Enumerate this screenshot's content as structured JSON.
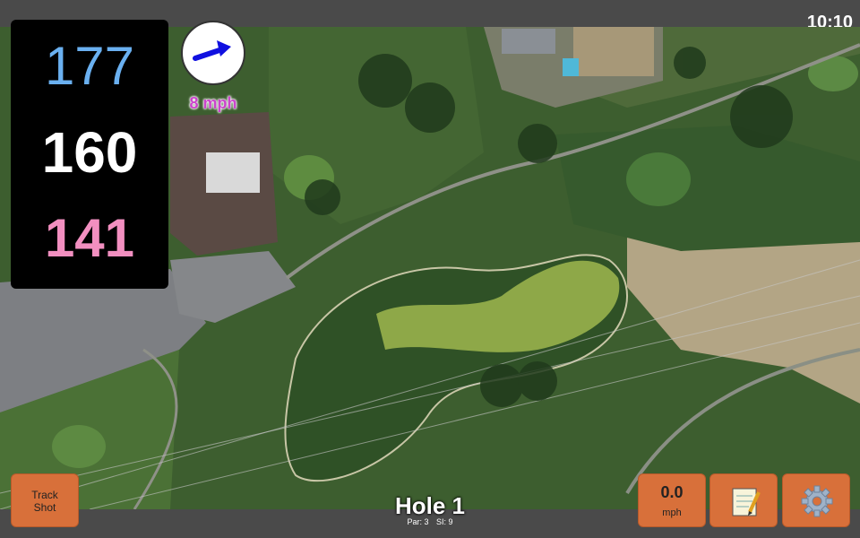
{
  "status": {
    "time": "10:10"
  },
  "yardages": {
    "back": "177",
    "middle": "160",
    "front": "141"
  },
  "wind": {
    "speed_label": "8 mph",
    "direction": "east",
    "icon": "wind-arrow-icon"
  },
  "hole": {
    "title": "Hole 1",
    "par_label": "Par: 3",
    "stroke_index_label": "SI: 9"
  },
  "buttons": {
    "track_shot_line1": "Track",
    "track_shot_line2": "Shot",
    "speed_value": "0.0",
    "speed_unit": "mph",
    "notes_icon": "notepad-icon",
    "settings_icon": "gear-icon"
  },
  "colors": {
    "back_yardage": "#6ab0f0",
    "middle_yardage": "#ffffff",
    "front_yardage": "#f28fc0",
    "button_bg": "#d8703a",
    "wind_text": "#cc44cc"
  }
}
